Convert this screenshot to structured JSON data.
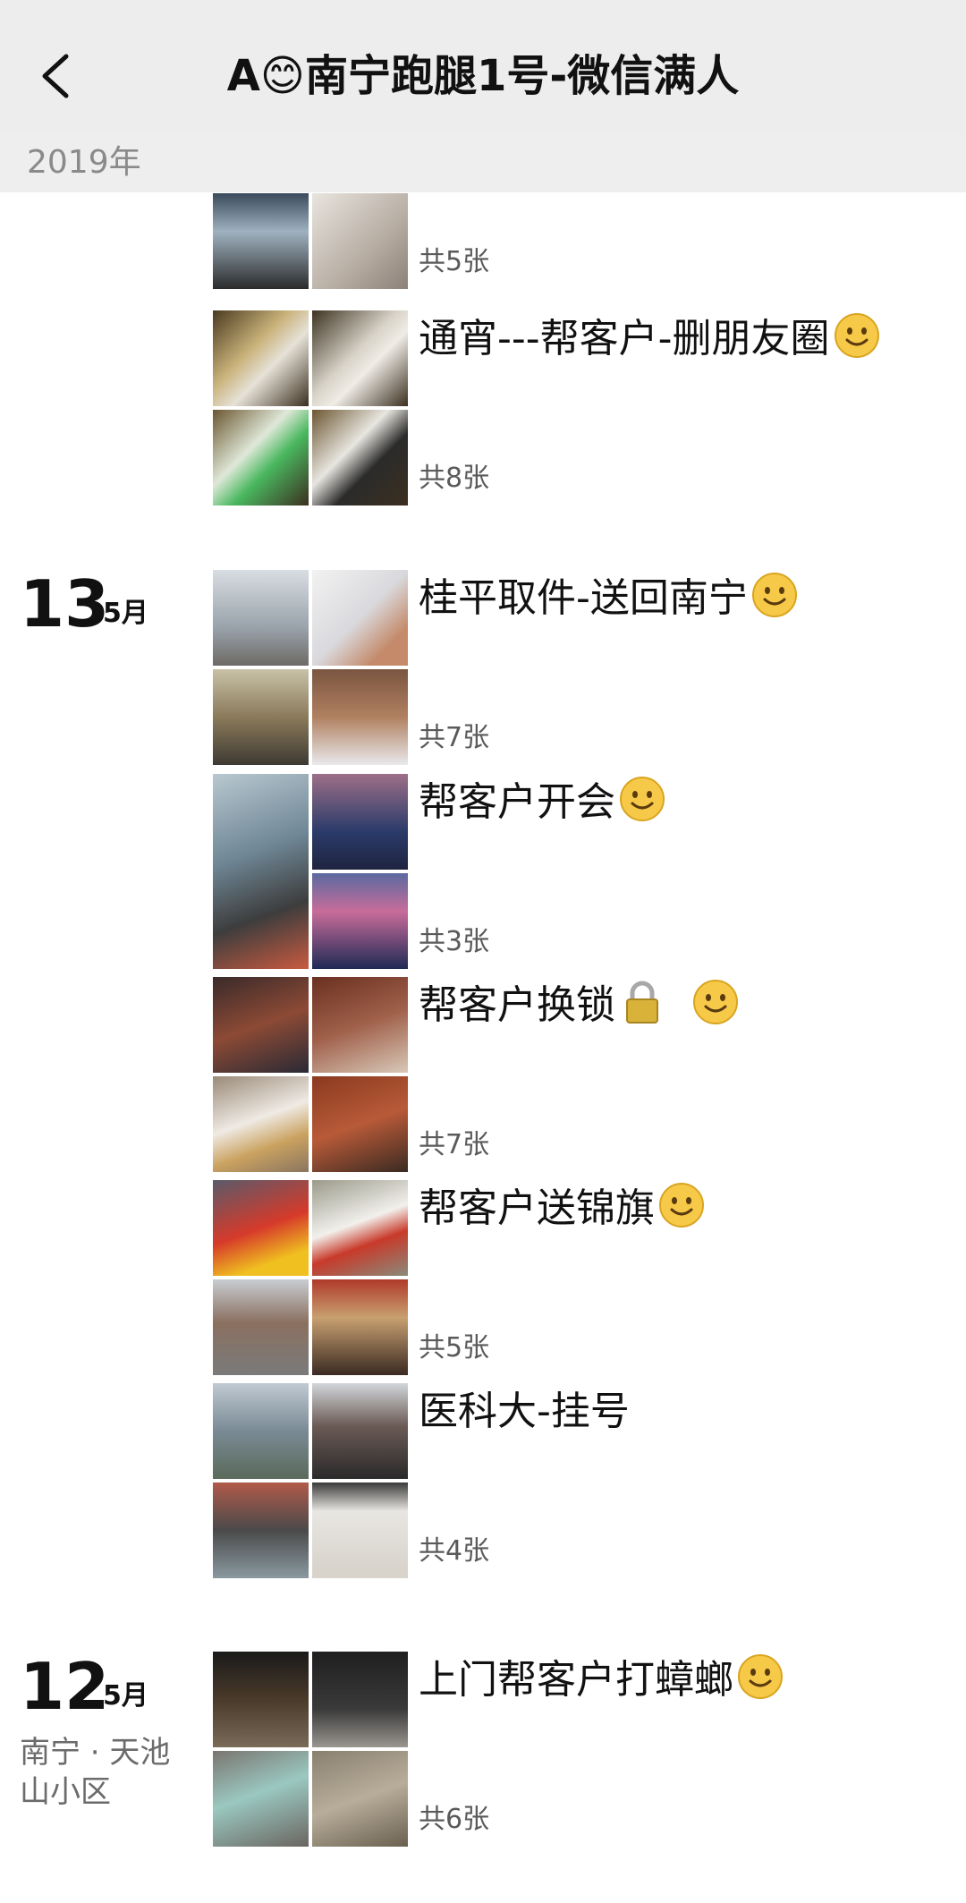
{
  "header": {
    "title_prefix": "A",
    "title_emoji": "😊",
    "title_main": "南宁跑腿1号-微信满人"
  },
  "year_label": "2019年",
  "entries": [
    {
      "caption": "",
      "count": "共5张",
      "emoji": false,
      "lock": false
    },
    {
      "caption": "通宵---帮客户-删朋友圈",
      "count": "共8张",
      "emoji": true,
      "lock": false
    },
    {
      "caption": "桂平取件-送回南宁",
      "count": "共7张",
      "emoji": true,
      "lock": false
    },
    {
      "caption": "帮客户开会",
      "count": "共3张",
      "emoji": true,
      "lock": false
    },
    {
      "caption": "帮客户换锁",
      "count": "共7张",
      "emoji": true,
      "lock": true
    },
    {
      "caption": "帮客户送锦旗",
      "count": "共5张",
      "emoji": true,
      "lock": false
    },
    {
      "caption": "医科大-挂号",
      "count": "共4张",
      "emoji": false,
      "lock": false
    },
    {
      "caption": "上门帮客户打蟑螂",
      "count": "共6张",
      "emoji": true,
      "lock": false
    }
  ],
  "dates": [
    {
      "day": "13",
      "month": "5月"
    },
    {
      "day": "12",
      "month": "5月",
      "location": "南宁 · 天池山小区"
    }
  ],
  "icons": {
    "back": "chevron-left-icon",
    "smile": "smile-emoji-icon",
    "lock": "lock-emoji-icon"
  },
  "colors": {
    "navbar_bg": "#ededed",
    "year_bg": "#eeeeee",
    "count_text": "#5a5a5a"
  }
}
